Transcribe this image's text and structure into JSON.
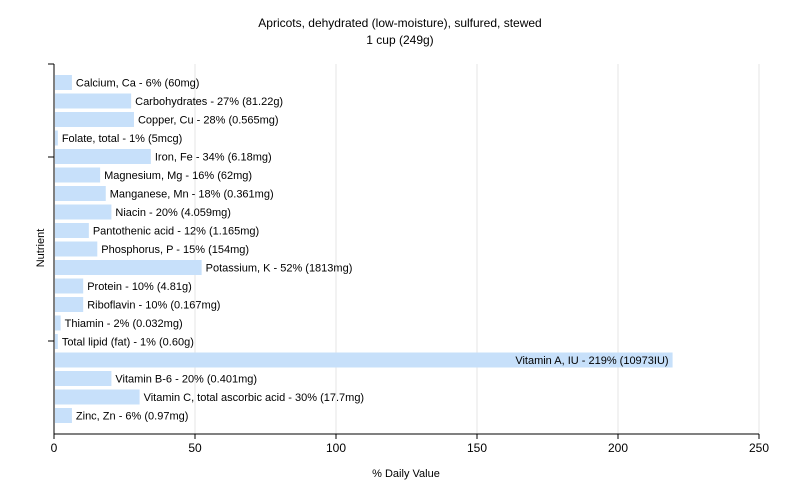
{
  "chart_data": {
    "type": "bar",
    "orientation": "horizontal",
    "title": "Apricots, dehydrated (low-moisture), sulfured, stewed",
    "subtitle": "1 cup (249g)",
    "xlabel": "% Daily Value",
    "ylabel": "Nutrient",
    "xlim": [
      0,
      250
    ],
    "xticks": [
      0,
      50,
      100,
      150,
      200,
      250
    ],
    "grid": true,
    "bar_color": "#c7e0fa",
    "grid_color": "#e6e6e6",
    "bars": [
      {
        "label": "Calcium, Ca - 6% (60mg)",
        "value": 6
      },
      {
        "label": "Carbohydrates - 27% (81.22g)",
        "value": 27
      },
      {
        "label": "Copper, Cu - 28% (0.565mg)",
        "value": 28
      },
      {
        "label": "Folate, total - 1% (5mcg)",
        "value": 1
      },
      {
        "label": "Iron, Fe - 34% (6.18mg)",
        "value": 34
      },
      {
        "label": "Magnesium, Mg - 16% (62mg)",
        "value": 16
      },
      {
        "label": "Manganese, Mn - 18% (0.361mg)",
        "value": 18
      },
      {
        "label": "Niacin - 20% (4.059mg)",
        "value": 20
      },
      {
        "label": "Pantothenic acid - 12% (1.165mg)",
        "value": 12
      },
      {
        "label": "Phosphorus, P - 15% (154mg)",
        "value": 15
      },
      {
        "label": "Potassium, K - 52% (1813mg)",
        "value": 52
      },
      {
        "label": "Protein - 10% (4.81g)",
        "value": 10
      },
      {
        "label": "Riboflavin - 10% (0.167mg)",
        "value": 10
      },
      {
        "label": "Thiamin - 2% (0.032mg)",
        "value": 2
      },
      {
        "label": "Total lipid (fat) - 1% (0.60g)",
        "value": 1
      },
      {
        "label": "Vitamin A, IU - 219% (10973IU)",
        "value": 219
      },
      {
        "label": "Vitamin B-6 - 20% (0.401mg)",
        "value": 20
      },
      {
        "label": "Vitamin C, total ascorbic acid - 30% (17.7mg)",
        "value": 30
      },
      {
        "label": "Zinc, Zn - 6% (0.97mg)",
        "value": 6
      }
    ]
  }
}
